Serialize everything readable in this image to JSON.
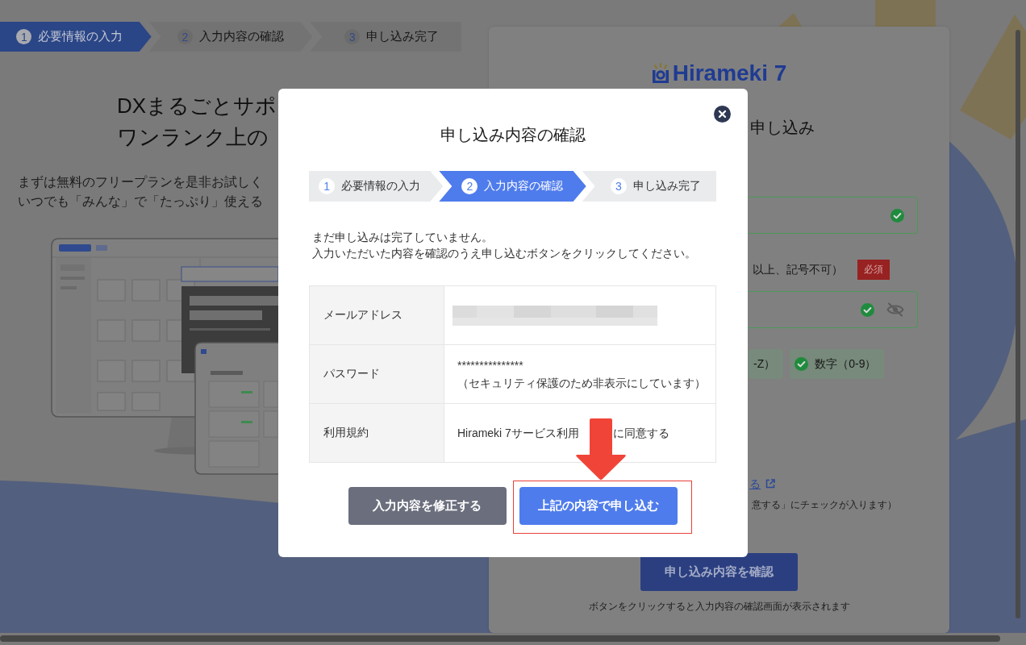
{
  "page_stepper": {
    "steps": [
      {
        "number": "1",
        "label": "必要情報の入力",
        "selected": true
      },
      {
        "number": "2",
        "label": "入力内容の確認",
        "selected": false
      },
      {
        "number": "3",
        "label": "申し込み完了",
        "selected": false
      }
    ]
  },
  "intro": {
    "heading_lines": [
      "DXまるごとサポ",
      "ワンランク上の"
    ],
    "text_lines": [
      "まずは無料のフリープランを是非お試しく",
      "いつでも「みんな」で「たっぷり」使える"
    ]
  },
  "signup_panel": {
    "logo": "Hirameki 7",
    "heading": "申し込み",
    "email_field": {
      "valid": true
    },
    "password_label": "以上、記号不可）",
    "required_badge": "必須",
    "password_field": {
      "valid": true,
      "masked": true
    },
    "password_rules": [
      {
        "label": "-Z）",
        "checked": true,
        "icon": false
      },
      {
        "label": "数字（0-9）",
        "checked": true,
        "icon": true
      }
    ],
    "terms_link": "る",
    "terms_note": "意する」にチェックが入ります）",
    "confirm_button": "申し込み内容を確認",
    "button_note": "ボタンをクリックすると入力内容の確認画面が表示されます"
  },
  "dialog": {
    "title": "申し込み内容の確認",
    "steps": [
      {
        "number": "1",
        "label": "必要情報の入力",
        "selected": false
      },
      {
        "number": "2",
        "label": "入力内容の確認",
        "selected": true
      },
      {
        "number": "3",
        "label": "申し込み完了",
        "selected": false
      }
    ],
    "notice_lines": [
      "まだ申し込みは完了していません。",
      "入力いただいた内容を確認のうえ申し込むボタンをクリックしてください。"
    ],
    "rows": [
      {
        "label": "メールアドレス",
        "kind": "redacted"
      },
      {
        "label": "パスワード",
        "kind": "lines",
        "values": [
          "***************",
          "（セキュリティ保護のため非表示にしています）"
        ]
      },
      {
        "label": "利用規約",
        "kind": "split",
        "values": [
          "Hirameki 7サービス利用",
          "に同意する"
        ]
      }
    ],
    "buttons": [
      {
        "label": "入力内容を修正する",
        "kind": "secondary",
        "highlighted": false
      },
      {
        "label": "上記の内容で申し込む",
        "kind": "primary",
        "highlighted": true
      }
    ]
  }
}
